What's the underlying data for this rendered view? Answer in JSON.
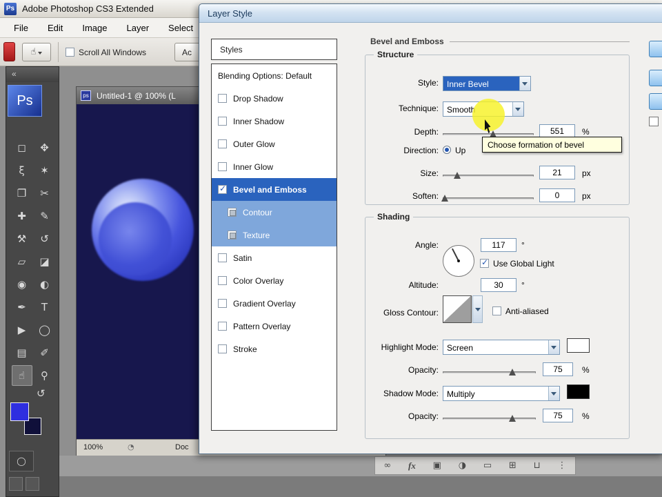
{
  "app": {
    "title": "Adobe Photoshop CS3 Extended",
    "logo": "Ps",
    "menus": [
      "File",
      "Edit",
      "Image",
      "Layer",
      "Select"
    ],
    "options": {
      "scroll_all_windows_label": "Scroll All Windows",
      "partial_button_label": "Ac"
    }
  },
  "tools": {
    "collapse_glyph": "«",
    "logo": "Ps",
    "rotate_glyph": "↺",
    "quick_mask_glyph": "◯",
    "items": [
      {
        "name": "rectangular-marquee",
        "glyph": "◻"
      },
      {
        "name": "move",
        "glyph": "✥"
      },
      {
        "name": "lasso",
        "glyph": "ξ"
      },
      {
        "name": "quick-selection",
        "glyph": "✶"
      },
      {
        "name": "crop",
        "glyph": "❐"
      },
      {
        "name": "slice",
        "glyph": "✂"
      },
      {
        "name": "spot-healing-brush",
        "glyph": "✚"
      },
      {
        "name": "brush",
        "glyph": "✎"
      },
      {
        "name": "clone-stamp",
        "glyph": "⚒"
      },
      {
        "name": "history-brush",
        "glyph": "↺"
      },
      {
        "name": "eraser",
        "glyph": "▱"
      },
      {
        "name": "gradient",
        "glyph": "◪"
      },
      {
        "name": "blur",
        "glyph": "◉"
      },
      {
        "name": "dodge",
        "glyph": "◐"
      },
      {
        "name": "pen",
        "glyph": "✒"
      },
      {
        "name": "type",
        "glyph": "T"
      },
      {
        "name": "path-selection",
        "glyph": "▶"
      },
      {
        "name": "ellipse",
        "glyph": "◯"
      },
      {
        "name": "notes",
        "glyph": "▤"
      },
      {
        "name": "eyedropper",
        "glyph": "✐"
      },
      {
        "name": "hand",
        "glyph": "☝",
        "active": true
      },
      {
        "name": "zoom",
        "glyph": "⚲"
      }
    ]
  },
  "document": {
    "title": "Untitled-1 @ 100% (L",
    "icon_label": "ps",
    "zoom": "100%",
    "status_icon_glyph": "◔",
    "status_partial": "Doc"
  },
  "dialog": {
    "title": "Layer Style",
    "styles_header": "Styles",
    "items": [
      {
        "label": "Blending Options: Default"
      },
      {
        "label": "Drop Shadow",
        "checked": false
      },
      {
        "label": "Inner Shadow",
        "checked": false
      },
      {
        "label": "Outer Glow",
        "checked": false
      },
      {
        "label": "Inner Glow",
        "checked": false
      },
      {
        "label": "Bevel and Emboss",
        "checked": true,
        "selected": true
      },
      {
        "label": "Contour",
        "sub": true,
        "checked": false
      },
      {
        "label": "Texture",
        "sub": true,
        "checked": false
      },
      {
        "label": "Satin",
        "checked": false
      },
      {
        "label": "Color Overlay",
        "checked": false
      },
      {
        "label": "Gradient Overlay",
        "checked": false
      },
      {
        "label": "Pattern Overlay",
        "checked": false
      },
      {
        "label": "Stroke",
        "checked": false
      }
    ],
    "panel_title": "Bevel and Emboss",
    "structure": {
      "legend": "Structure",
      "style_label": "Style:",
      "style_value": "Inner Bevel",
      "technique_label": "Technique:",
      "technique_value": "Smooth",
      "depth_label": "Depth:",
      "depth_value": "551",
      "depth_unit": "%",
      "depth_pct": 55,
      "direction_label": "Direction:",
      "direction_up_label": "Up",
      "direction_up_selected": true,
      "size_label": "Size:",
      "size_value": "21",
      "size_unit": "px",
      "size_pct": 16,
      "soften_label": "Soften:",
      "soften_value": "0",
      "soften_unit": "px",
      "soften_pct": 2
    },
    "tooltip": "Choose formation of bevel",
    "shading": {
      "legend": "Shading",
      "angle_label": "Angle:",
      "angle_value": "117",
      "angle_unit": "°",
      "use_global_light_label": "Use Global Light",
      "use_global_light_checked": true,
      "altitude_label": "Altitude:",
      "altitude_value": "30",
      "altitude_unit": "°",
      "gloss_contour_label": "Gloss Contour:",
      "anti_aliased_label": "Anti-aliased",
      "anti_aliased_checked": false,
      "highlight_mode_label": "Highlight Mode:",
      "highlight_mode_value": "Screen",
      "highlight_opacity_label": "Opacity:",
      "highlight_opacity_value": "75",
      "highlight_opacity_unit": "%",
      "highlight_opacity_pct": 75,
      "shadow_mode_label": "Shadow Mode:",
      "shadow_mode_value": "Multiply",
      "shadow_opacity_label": "Opacity:",
      "shadow_opacity_value": "75",
      "shadow_opacity_unit": "%",
      "shadow_opacity_pct": 75
    }
  },
  "layers_bar": {
    "icons": [
      {
        "name": "link-layers",
        "glyph": "∞"
      },
      {
        "name": "layer-style-fx",
        "glyph": "fx"
      },
      {
        "name": "layer-mask",
        "glyph": "▣"
      },
      {
        "name": "adjustment-layer",
        "glyph": "◑"
      },
      {
        "name": "layer-group",
        "glyph": "▭"
      },
      {
        "name": "new-layer",
        "glyph": "⊞"
      },
      {
        "name": "delete-layer",
        "glyph": "⊔"
      },
      {
        "name": "panel-grip",
        "glyph": "⋮"
      }
    ]
  },
  "colors": {
    "selection_blue": "#2a63be",
    "subitem_blue": "#7fa7db",
    "canvas_navy": "#17174d",
    "sphere_blue": "#4553dc",
    "highlight_yellow": "#f7f126",
    "tooltip_bg": "#ffffdf",
    "highlight_swatch": "#ffffff",
    "shadow_swatch": "#000000",
    "foreground_swatch": "#2e2ee0",
    "background_swatch": "#10103a"
  }
}
